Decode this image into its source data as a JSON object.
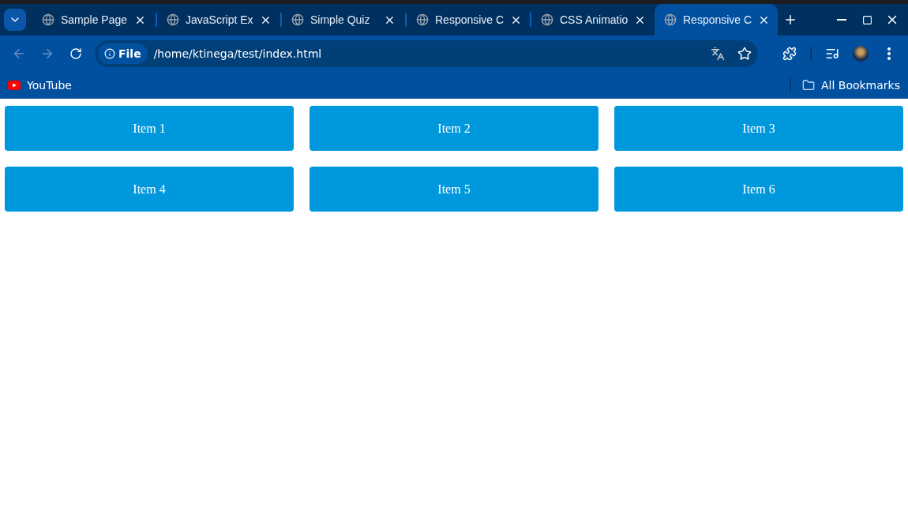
{
  "tabs": [
    {
      "title": "Sample Page",
      "selected": false
    },
    {
      "title": "JavaScript Ex",
      "selected": false
    },
    {
      "title": "Simple Quiz",
      "selected": false
    },
    {
      "title": "Responsive C",
      "selected": false
    },
    {
      "title": "CSS Animatio",
      "selected": false
    },
    {
      "title": "Responsive C",
      "selected": true
    }
  ],
  "address": {
    "scheme": "File",
    "url": "/home/ktinega/test/index.html"
  },
  "bookmarks": [
    {
      "label": "YouTube"
    }
  ],
  "all_bookmarks": "All Bookmarks",
  "items": [
    "Item 1",
    "Item 2",
    "Item 3",
    "Item 4",
    "Item 5",
    "Item 6"
  ]
}
